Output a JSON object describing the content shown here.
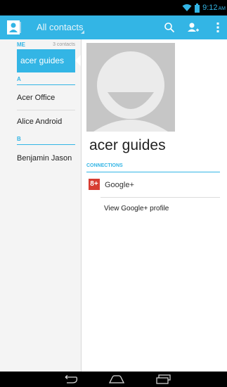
{
  "status_bar": {
    "time": "9:12",
    "ampm": "AM"
  },
  "action_bar": {
    "title": "All contacts"
  },
  "contacts": {
    "me_header": "ME",
    "me_count": "3 contacts",
    "selected": "acer guides",
    "sections": [
      {
        "letter": "A",
        "items": [
          "Acer Office",
          "Alice Android"
        ]
      },
      {
        "letter": "B",
        "items": [
          "Benjamin Jason"
        ]
      }
    ]
  },
  "detail": {
    "name": "acer guides",
    "connections_header": "CONNECTIONS",
    "gplus_badge": "8+",
    "gplus_label": "Google+",
    "view_profile": "View Google+ profile"
  },
  "colors": {
    "accent": "#33b5e5",
    "gplus": "#d73d32"
  },
  "icons": {
    "status": [
      "wifi-icon",
      "battery-icon"
    ],
    "action_bar": [
      "contacts-app-icon",
      "search-icon",
      "add-contact-icon",
      "overflow-menu-icon"
    ],
    "nav": [
      "back-icon",
      "home-icon",
      "recents-icon"
    ]
  }
}
